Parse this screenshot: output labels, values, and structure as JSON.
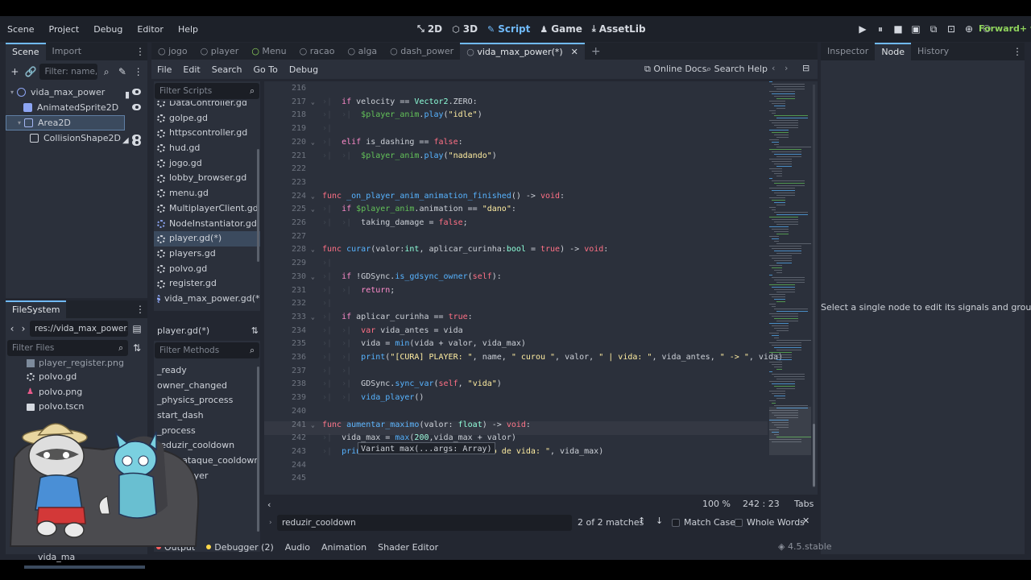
{
  "menus": [
    "Scene",
    "Project",
    "Debug",
    "Editor",
    "Help"
  ],
  "workspaces": [
    {
      "label": "2D",
      "icon": "2d-icon",
      "active": false
    },
    {
      "label": "3D",
      "icon": "3d-icon",
      "active": false
    },
    {
      "label": "Script",
      "icon": "script-icon",
      "active": true
    },
    {
      "label": "Game",
      "icon": "game-icon",
      "active": false
    },
    {
      "label": "AssetLib",
      "icon": "assetlib-icon",
      "active": false
    }
  ],
  "renderer": "Forward+",
  "scene_dock": {
    "tabs": [
      "Scene",
      "Import"
    ],
    "filter_placeholder": "Filter: name, t:t",
    "nodes": [
      {
        "label": "vida_max_power",
        "depth": 0
      },
      {
        "label": "AnimatedSprite2D",
        "depth": 1
      },
      {
        "label": "Area2D",
        "depth": 1
      },
      {
        "label": "CollisionShape2D",
        "depth": 2
      }
    ]
  },
  "filesystem": {
    "tab": "FileSystem",
    "path": "res://vida_max_power.png",
    "filter_placeholder": "Filter Files",
    "items": [
      "player_register.png",
      "polvo.gd",
      "polvo.png",
      "polvo.tscn"
    ],
    "partial_item": "vida_ma"
  },
  "editor_tabs": [
    {
      "label": "jogo",
      "active": false
    },
    {
      "label": "player",
      "active": false
    },
    {
      "label": "Menu",
      "active": false
    },
    {
      "label": "racao",
      "active": false
    },
    {
      "label": "alga",
      "active": false
    },
    {
      "label": "dash_power",
      "active": false
    },
    {
      "label": "vida_max_power(*)",
      "active": true
    }
  ],
  "script_menu": [
    "File",
    "Edit",
    "Search",
    "Go To",
    "Debug"
  ],
  "online_docs": "Online Docs",
  "search_help": "Search Help",
  "scripts": {
    "filter_placeholder": "Filter Scripts",
    "items": [
      "DataController.gd",
      "golpe.gd",
      "httpscontroller.gd",
      "hud.gd",
      "jogo.gd",
      "lobby_browser.gd",
      "menu.gd",
      "MultiplayerClient.gd",
      "NodeInstantiator.gd",
      "player.gd(*)",
      "players.gd",
      "polvo.gd",
      "register.gd",
      "vida_max_power.gd(*)"
    ],
    "current": "player.gd(*)"
  },
  "methods": {
    "filter_placeholder": "Filter Methods",
    "items": [
      "_ready",
      "owner_changed",
      "_physics_process",
      "start_dash",
      "_process",
      "reduzir_cooldown",
      "start_ataque_cooldown",
      "vida_player"
    ]
  },
  "tooltip": "Variant max(...args: Array)",
  "status": {
    "zoom": "100 %",
    "line": "242",
    "col": "23",
    "indent": "Tabs"
  },
  "find_bar": {
    "query": "reduzir_cooldown",
    "matches": "2 of 2 matches",
    "match_case": "Match Case",
    "whole_words": "Whole Words"
  },
  "bottom_tabs": [
    "Output",
    "Debugger (2)",
    "Audio",
    "Animation",
    "Shader Editor"
  ],
  "version": "4.5.stable",
  "inspector": {
    "tabs": [
      "Inspector",
      "Node",
      "History"
    ],
    "message": "Select a single node to edit its signals and groups."
  },
  "code_lines": [
    {
      "n": "216",
      "fold": false,
      "html": ""
    },
    {
      "n": "217",
      "fold": true,
      "html": "<span class='guide'>›|  </span><span class='kwc'>if</span> velocity == <span class='ty'>Vector2</span>.ZERO:"
    },
    {
      "n": "218",
      "fold": false,
      "html": "<span class='guide'>›|  ›|  </span><span class='nodepath'>$player_anim</span>.<span class='fn'>play</span>(<span class='str'>\"idle\"</span>)"
    },
    {
      "n": "219",
      "fold": false,
      "html": "<span class='guide'>›|</span>"
    },
    {
      "n": "220",
      "fold": true,
      "html": "<span class='guide'>›|  </span><span class='kwc'>elif</span> is_dashing == <span class='bool'>false</span>:"
    },
    {
      "n": "221",
      "fold": false,
      "html": "<span class='guide'>›|  ›|  </span><span class='nodepath'>$player_anim</span>.<span class='fn'>play</span>(<span class='str'>\"nadando\"</span>)"
    },
    {
      "n": "222",
      "fold": false,
      "html": ""
    },
    {
      "n": "223",
      "fold": false,
      "html": ""
    },
    {
      "n": "224",
      "fold": true,
      "html": "<span class='kw'>func</span> <span class='fn'>_on_player_anim_animation_finished</span>() -> <span class='kw'>void</span>:"
    },
    {
      "n": "225",
      "fold": true,
      "html": "<span class='guide'>›|  </span><span class='kwc'>if</span> <span class='nodepath'>$player_anim</span>.animation == <span class='str'>\"dano\"</span>:"
    },
    {
      "n": "226",
      "fold": false,
      "html": "<span class='guide'>›|  ›|  </span>taking_damage = <span class='bool'>false</span>;"
    },
    {
      "n": "227",
      "fold": false,
      "html": ""
    },
    {
      "n": "228",
      "fold": true,
      "html": "<span class='kw'>func</span> <span class='fn'>curar</span>(valor:<span class='ty'>int</span>, aplicar_curinha:<span class='ty'>bool</span> = <span class='bool'>true</span>) -> <span class='kw'>void</span>:"
    },
    {
      "n": "229",
      "fold": false,
      "html": "<span class='guide'>›|</span>"
    },
    {
      "n": "230",
      "fold": true,
      "html": "<span class='guide'>›|  </span><span class='kwc'>if</span> !GDSync.<span class='fn'>is_gdsync_owner</span>(<span class='kw'>self</span>):"
    },
    {
      "n": "231",
      "fold": false,
      "html": "<span class='guide'>›|  ›|  </span><span class='kwc'>return</span>;"
    },
    {
      "n": "232",
      "fold": false,
      "html": "<span class='guide'>›|</span>"
    },
    {
      "n": "233",
      "fold": true,
      "html": "<span class='guide'>›|  </span><span class='kwc'>if</span> aplicar_curinha == <span class='bool'>true</span>:"
    },
    {
      "n": "234",
      "fold": false,
      "html": "<span class='guide'>›|  ›|  </span><span class='kw'>var</span> vida_antes = vida"
    },
    {
      "n": "235",
      "fold": false,
      "html": "<span class='guide'>›|  ›|  </span>vida = <span class='fn'>min</span>(vida + valor, vida_max)"
    },
    {
      "n": "236",
      "fold": false,
      "html": "<span class='guide'>›|  ›|  </span><span class='fn'>print</span>(<span class='str'>\"[CURA] PLAYER: \"</span>, name, <span class='str'>\" curou \"</span>, valor, <span class='str'>\" | vida: \"</span>, vida_antes, <span class='str'>\" -> \"</span>, vida)"
    },
    {
      "n": "237",
      "fold": false,
      "html": "<span class='guide'>›|  ›|</span>"
    },
    {
      "n": "238",
      "fold": false,
      "html": "<span class='guide'>›|  ›|  </span>GDSync.<span class='fn'>sync_var</span>(<span class='kw'>self</span>, <span class='str'>\"vida\"</span>)"
    },
    {
      "n": "239",
      "fold": false,
      "html": "<span class='guide'>›|  ›|  </span><span class='fn'>vida_player</span>()"
    },
    {
      "n": "240",
      "fold": false,
      "html": ""
    },
    {
      "n": "241",
      "fold": true,
      "html": "<span class='kw'>func</span> <span class='fn'>aumentar_maximo</span>(valor: <span class='ty'>float</span>) -> <span class='kw'>void</span>:"
    },
    {
      "n": "242",
      "fold": false,
      "html": "<span class='guide'>›|  </span>vida_max = <span class='fn'>max</span>(<span class='num'>200</span>,vida_max + valor)"
    },
    {
      "n": "243",
      "fold": false,
      "html": "<span class='guide'>›|  </span><span class='fn'>prin</span>                       <span class='str'>aximo de vida: \"</span>, vida_max)"
    },
    {
      "n": "244",
      "fold": false,
      "html": ""
    },
    {
      "n": "245",
      "fold": false,
      "html": ""
    }
  ]
}
